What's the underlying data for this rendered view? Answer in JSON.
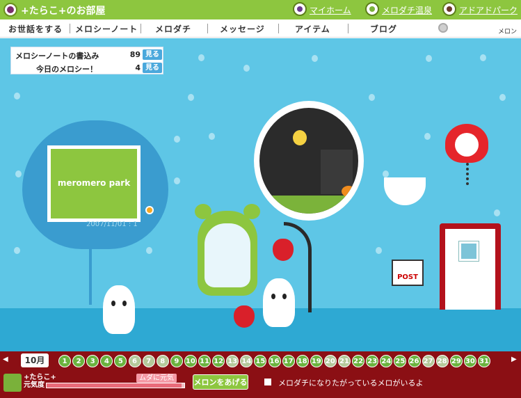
{
  "header": {
    "room_title": "+たらこ+のお部屋",
    "links": [
      "マイホーム",
      "メロダチ温泉",
      "アドアドパーク"
    ]
  },
  "nav": {
    "items": [
      "お世話をする",
      "メロシーノート",
      "メロダチ",
      "メッセージ",
      "アイテム",
      "ブログ"
    ],
    "melon_label": "メロン"
  },
  "counter": {
    "rows": [
      {
        "label": "メロシーノートの書込み",
        "value": "89",
        "button": "見る"
      },
      {
        "label": "今日のメロシー！",
        "value": "4",
        "button": "見る"
      }
    ]
  },
  "tv": {
    "logo": "meromero park",
    "date": "2007/11/01 : 1"
  },
  "post_label": "POST",
  "calendar": {
    "month": "10月",
    "days": [
      "1",
      "2",
      "3",
      "4",
      "5",
      "6",
      "7",
      "8",
      "9",
      "10",
      "11",
      "12",
      "13",
      "14",
      "15",
      "16",
      "17",
      "18",
      "19",
      "20",
      "21",
      "22",
      "23",
      "24",
      "25",
      "26",
      "27",
      "28",
      "29",
      "30",
      "31"
    ],
    "dim_days": [
      6,
      7,
      8,
      13,
      14,
      20,
      21,
      27,
      28
    ],
    "prev_arrow": "◀",
    "next_arrow": "▶"
  },
  "status": {
    "name_line1": "+たらこ+",
    "name_line2": "元気度",
    "mood": "ムダに元気",
    "gauge_level": 0.98,
    "give_button": "メロンをあげる",
    "checkbox_label": "メロダチになりたがっているメロがいるよ"
  },
  "colors": {
    "header_green": "#8dc63f",
    "sky_blue": "#5ec6e6",
    "footer_red": "#8b0f14"
  }
}
